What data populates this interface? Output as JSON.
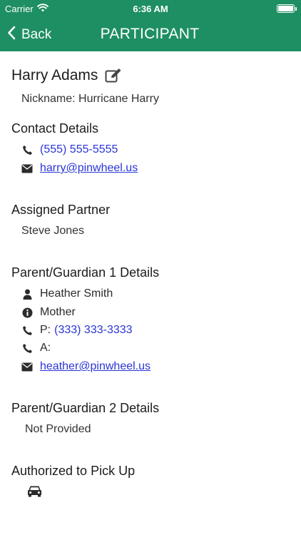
{
  "status": {
    "carrier": "Carrier",
    "time": "6:36 AM"
  },
  "nav": {
    "back_label": "Back",
    "title": "PARTICIPANT"
  },
  "participant": {
    "name": "Harry Adams",
    "nickname": "Nickname: Hurricane Harry"
  },
  "contact": {
    "heading": "Contact Details",
    "phone": "(555) 555-5555",
    "email": "harry@pinwheel.us"
  },
  "partner": {
    "heading": "Assigned Partner",
    "name": "Steve Jones"
  },
  "guardian1": {
    "heading": "Parent/Guardian 1 Details",
    "name": "Heather Smith",
    "relation": "Mother",
    "phone_prefix": "P:",
    "phone": "(333) 333-3333",
    "alt_prefix": "A:",
    "email": "heather@pinwheel.us"
  },
  "guardian2": {
    "heading": "Parent/Guardian 2 Details",
    "value": "Not Provided"
  },
  "pickup": {
    "heading": "Authorized to Pick Up"
  },
  "colors": {
    "header": "#1e8f63",
    "link": "#2a35d6"
  }
}
